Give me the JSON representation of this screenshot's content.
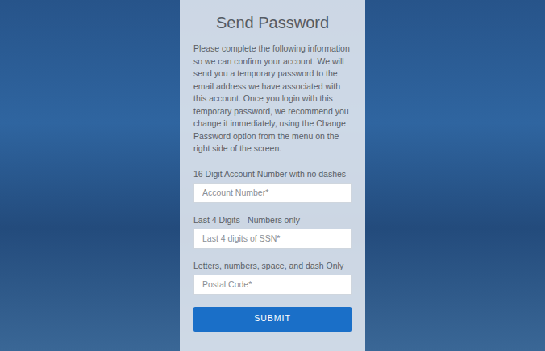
{
  "form": {
    "title": "Send Password",
    "description": "Please complete the following information so we can confirm your account. We will send you a temporary password to the email address we have associated with this account. Once you login with this temporary password, we recommend you change it immediately, using the Change Password option from the menu on the right side of the screen.",
    "fields": [
      {
        "label": "16 Digit Account Number with no dashes",
        "placeholder": "Account Number*"
      },
      {
        "label": "Last 4 Digits - Numbers only",
        "placeholder": "Last 4 digits of SSN*"
      },
      {
        "label": "Letters, numbers, space, and dash Only",
        "placeholder": "Postal Code*"
      }
    ],
    "button": "SUBMIT"
  }
}
